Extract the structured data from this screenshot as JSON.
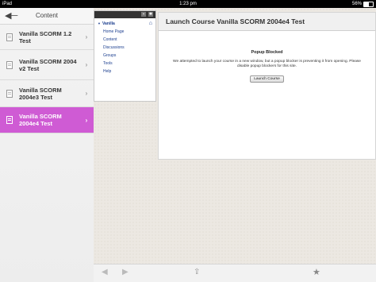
{
  "status": {
    "carrier": "iPad",
    "time": "1:23 pm",
    "battery": "56%",
    "battery_level": 0.56
  },
  "sidebar": {
    "header_title": "Content",
    "items": [
      {
        "label": "Vanilla SCORM 1.2 Test"
      },
      {
        "label": "Vanilla SCORM 2004 v2 Test"
      },
      {
        "label": "Vanilla SCORM 2004e3 Test"
      },
      {
        "label": "Vanilla SCORM 2004e4 Test"
      }
    ]
  },
  "nav": {
    "course": "Vanilla",
    "links": [
      {
        "label": "Home Page"
      },
      {
        "label": "Content"
      },
      {
        "label": "Discussions"
      },
      {
        "label": "Groups"
      },
      {
        "label": "Tools"
      },
      {
        "label": "Help"
      }
    ]
  },
  "main": {
    "title": "Launch Course Vanilla SCORM 2004e4 Test",
    "popup_title": "Popup Blocked",
    "popup_message": "We attempted to launch your course in a new window, but a popup blocker is preventing it from opening. Please disable popup blockers for this site.",
    "launch_button": "Launch Course"
  },
  "colors": {
    "active_item": "#cf5bd4",
    "link": "#1c3f8f"
  }
}
